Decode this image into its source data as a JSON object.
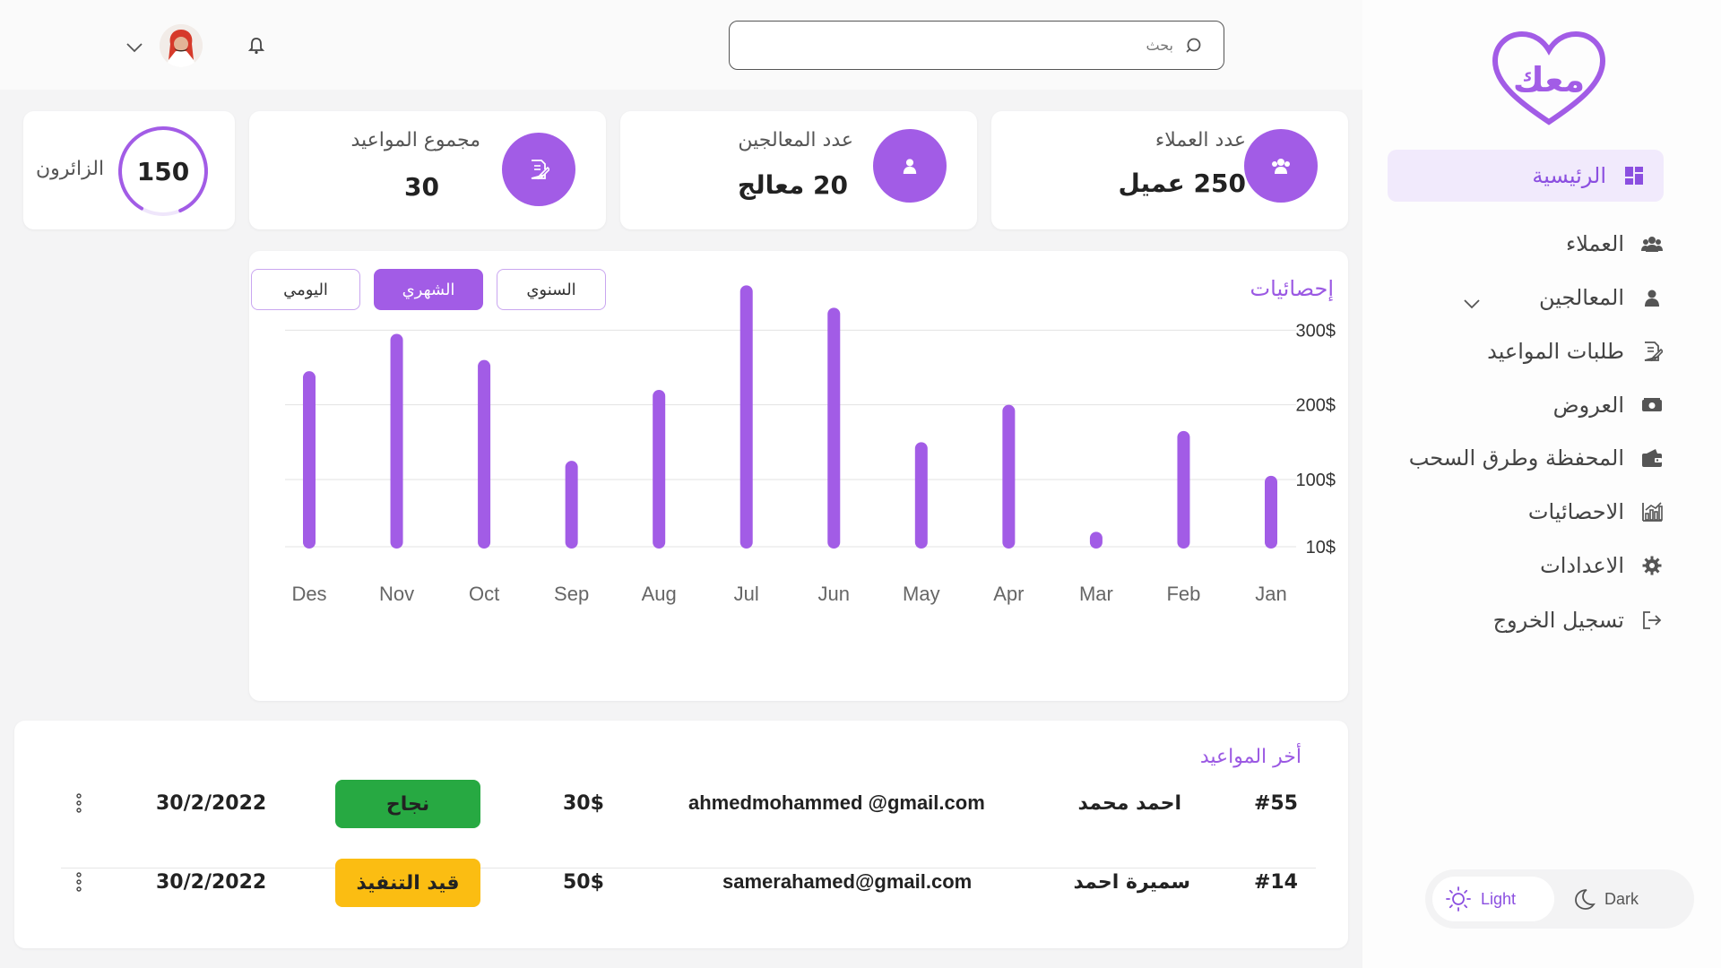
{
  "brand": {
    "logo_text": "معك",
    "color": "#9b59e3"
  },
  "header": {
    "search_placeholder": "بحث",
    "icons": [
      "search-icon",
      "bell-icon",
      "chevron-down-icon"
    ]
  },
  "sidebar": {
    "items": [
      {
        "label": "الرئيسية",
        "icon": "dashboard-icon",
        "active": true
      },
      {
        "label": "العملاء",
        "icon": "users-icon"
      },
      {
        "label": "المعالجين",
        "icon": "user-icon",
        "has_submenu": true
      },
      {
        "label": "طلبات المواعيد",
        "icon": "edit-document-icon"
      },
      {
        "label": "العروض",
        "icon": "money-icon"
      },
      {
        "label": "المحفظة وطرق السحب",
        "icon": "wallet-icon"
      },
      {
        "label": "الاحصائيات",
        "icon": "bar-chart-icon"
      },
      {
        "label": "الاعدادات",
        "icon": "gear-icon"
      },
      {
        "label": "تسجيل الخروج",
        "icon": "logout-icon"
      }
    ],
    "theme": {
      "light_label": "Light",
      "dark_label": "Dark",
      "selected": "Light"
    }
  },
  "stats": {
    "clients": {
      "label": "عدد العملاء",
      "value": "250 عميل"
    },
    "therapists": {
      "label": "عدد المعالجين",
      "value": "20 معالج"
    },
    "appointments": {
      "label": "مجموع المواعيد",
      "value": "30"
    },
    "visitors": {
      "label": "الزائرون",
      "value": "150",
      "progress": 0.85
    }
  },
  "chart": {
    "title": "إحصائيات",
    "periods": [
      {
        "label": "السنوي",
        "active": false
      },
      {
        "label": "الشهري",
        "active": true
      },
      {
        "label": "اليومي",
        "active": false
      }
    ]
  },
  "chart_data": {
    "type": "bar",
    "title": "إحصائيات",
    "categories": [
      "Jan",
      "Feb",
      "Mar",
      "Apr",
      "May",
      "Jun",
      "Jul",
      "Aug",
      "Sep",
      "Oct",
      "Nov",
      "Des"
    ],
    "values": [
      105,
      165,
      30,
      200,
      150,
      330,
      360,
      220,
      125,
      260,
      295,
      245
    ],
    "ytick_labels": [
      "10$",
      "100$",
      "200$",
      "300$"
    ],
    "ytick_values": [
      10,
      100,
      200,
      300
    ],
    "ylim": [
      10,
      370
    ],
    "grid": true,
    "bar_color": "#a25ce6",
    "x_direction": "right-to-left"
  },
  "appointments_table": {
    "title": "أخر المواعيد",
    "rows": [
      {
        "id": "#55",
        "name": "احمد محمد",
        "email": "ahmedmohammed @gmail.com",
        "price": "30$",
        "status": "نجاح",
        "status_color": "#27a942",
        "date": "30/2/2022"
      },
      {
        "id": "#14",
        "name": "سميرة احمد",
        "email": "samerahamed@gmail.com",
        "price": "50$",
        "status": "قيد التنفيذ",
        "status_color": "#fbbd12",
        "date": "30/2/2022"
      }
    ]
  }
}
